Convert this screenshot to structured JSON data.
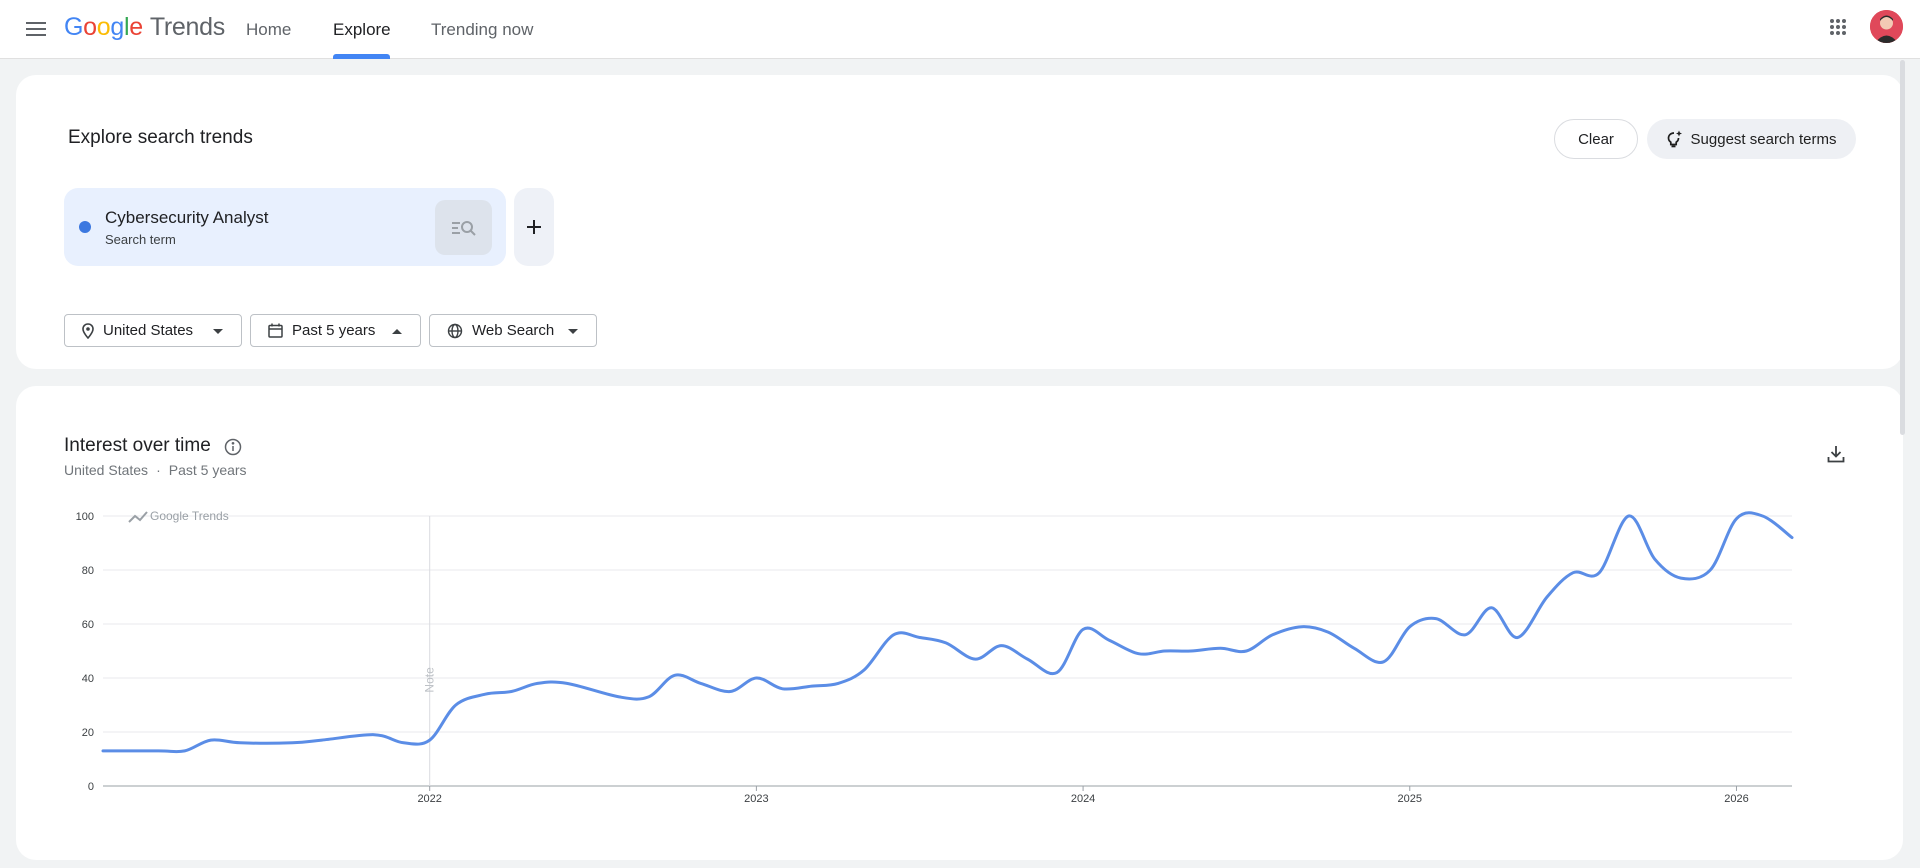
{
  "header": {
    "logo": {
      "g1": "G",
      "g2": "o",
      "g3": "o",
      "g4": "g",
      "g5": "l",
      "g6": "e",
      "product": "Trends"
    },
    "nav": [
      {
        "label": "Home",
        "active": false
      },
      {
        "label": "Explore",
        "active": true
      },
      {
        "label": "Trending now",
        "active": false
      }
    ],
    "icons": {
      "menu": "menu-icon",
      "apps": "apps-grid-icon",
      "avatar": "avatar"
    }
  },
  "explore": {
    "title": "Explore search trends",
    "clear_label": "Clear",
    "suggest_label": "Suggest search terms",
    "term": {
      "name": "Cybersecurity Analyst",
      "type": "Search term",
      "color": "#3c78e0"
    },
    "filters": {
      "region": "United States",
      "time": "Past 5 years",
      "property": "Web Search"
    }
  },
  "interest": {
    "title": "Interest over time",
    "subtitle_region": "United States",
    "subtitle_sep": "·",
    "subtitle_time": "Past 5 years",
    "watermark": "Google Trends",
    "note_label": "Note"
  },
  "colors": {
    "accent": "#4285f4",
    "line": "#5b8de6"
  },
  "chart_data": {
    "type": "line",
    "title": "Interest over time",
    "series": [
      {
        "name": "Cybersecurity Analyst",
        "x": [
          2021.0,
          2021.17,
          2021.25,
          2021.33,
          2021.42,
          2021.58,
          2021.67,
          2021.83,
          2021.92,
          2022.0,
          2022.08,
          2022.17,
          2022.25,
          2022.33,
          2022.42,
          2022.58,
          2022.67,
          2022.75,
          2022.83,
          2022.92,
          2023.0,
          2023.08,
          2023.17,
          2023.25,
          2023.33,
          2023.42,
          2023.5,
          2023.58,
          2023.67,
          2023.75,
          2023.83,
          2023.92,
          2024.0,
          2024.08,
          2024.17,
          2024.25,
          2024.33,
          2024.42,
          2024.5,
          2024.58,
          2024.67,
          2024.75,
          2024.83,
          2024.92,
          2025.0,
          2025.08,
          2025.17,
          2025.25,
          2025.33,
          2025.42,
          2025.5,
          2025.58,
          2025.67,
          2025.75,
          2025.83,
          2025.92,
          2026.0,
          2026.08,
          2026.17
        ],
        "values": [
          13,
          13,
          13,
          17,
          16,
          16,
          17,
          19,
          16,
          17,
          30,
          34,
          35,
          38,
          38,
          33,
          33,
          41,
          38,
          35,
          40,
          36,
          37,
          38,
          43,
          56,
          55,
          53,
          47,
          52,
          47,
          42,
          58,
          54,
          49,
          50,
          50,
          51,
          50,
          56,
          59,
          57,
          51,
          46,
          59,
          62,
          56,
          66,
          55,
          70,
          79,
          79,
          100,
          84,
          77,
          80,
          99,
          100,
          92
        ]
      }
    ],
    "x_ticks": [
      "2022",
      "2023",
      "2024",
      "2025",
      "2026"
    ],
    "y_ticks": [
      0,
      20,
      40,
      60,
      80,
      100
    ],
    "xlim": [
      2021.0,
      2026.17
    ],
    "ylim": [
      0,
      100
    ],
    "grid": true,
    "annotations": [
      {
        "label": "Note",
        "x": 2022.0
      }
    ]
  }
}
